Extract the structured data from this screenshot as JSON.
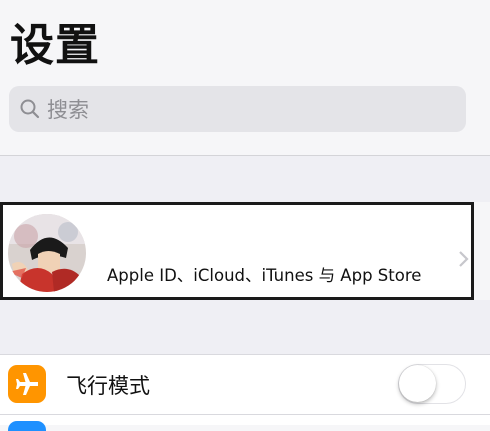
{
  "header": {
    "title": "设置"
  },
  "search": {
    "placeholder": "搜索",
    "icon": "search-icon"
  },
  "account": {
    "label": "Apple ID、iCloud、iTunes 与 App Store",
    "avatar": "profile-avatar",
    "chevron": "chevron-right-icon"
  },
  "settings": {
    "airplane_mode": {
      "label": "飞行模式",
      "icon": "airplane-icon",
      "icon_color": "#ff9500",
      "enabled": false
    }
  },
  "colors": {
    "background": "#efeff4",
    "search_field": "#e4e4e8",
    "placeholder_text": "#8e8e93",
    "airplane_icon_bg": "#ff9500",
    "next_icon_bg": "#1e90ff"
  }
}
